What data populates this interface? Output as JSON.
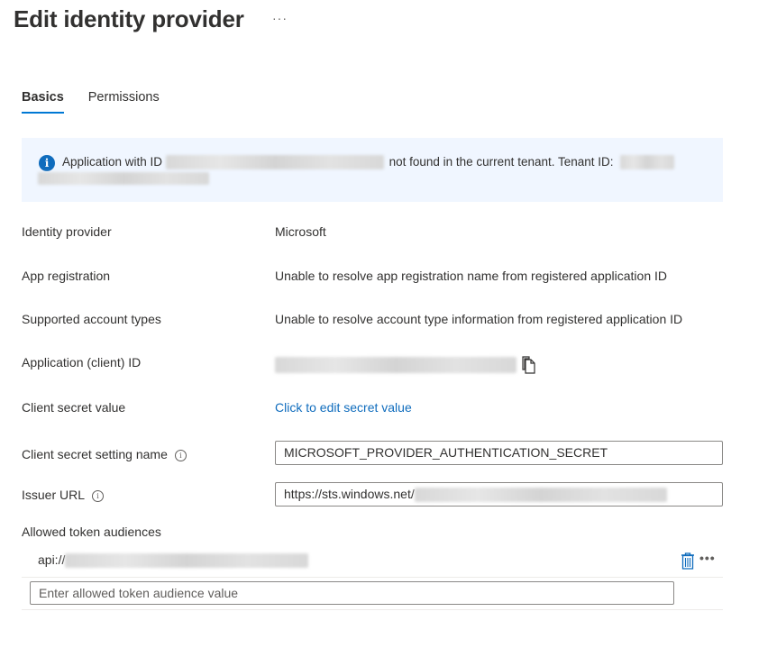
{
  "header": {
    "title": "Edit identity provider",
    "more_label": "···"
  },
  "tabs": [
    {
      "label": "Basics",
      "active": true
    },
    {
      "label": "Permissions",
      "active": false
    }
  ],
  "info_banner": {
    "icon": "info-icon",
    "text_before": "Application with ID",
    "text_middle": "not found in the current tenant. Tenant ID:",
    "redacted": true,
    "accent_color": "#0f6cbd",
    "background_color": "#f0f6ff"
  },
  "fields": {
    "identity_provider": {
      "label": "Identity provider",
      "value": "Microsoft"
    },
    "app_registration": {
      "label": "App registration",
      "value": "Unable to resolve app registration name from registered application ID"
    },
    "supported_account_types": {
      "label": "Supported account types",
      "value": "Unable to resolve account type information from registered application ID"
    },
    "application_client_id": {
      "label": "Application (client) ID",
      "value_redacted": true,
      "copy_icon": "copy-icon"
    },
    "client_secret_value": {
      "label": "Client secret value",
      "link": "Click to edit secret value"
    },
    "client_secret_setting_name": {
      "label": "Client secret setting name",
      "value": "MICROSOFT_PROVIDER_AUTHENTICATION_SECRET",
      "info_icon": "info-icon"
    },
    "issuer_url": {
      "label": "Issuer URL",
      "value_prefix": "https://sts.windows.net/",
      "info_icon": "info-icon"
    }
  },
  "allowed_token_audiences": {
    "label": "Allowed token audiences",
    "items": [
      {
        "prefix": "api://",
        "redacted": true
      }
    ],
    "input_placeholder": "Enter allowed token audience value",
    "more_label": "•••"
  },
  "colors": {
    "accent": "#0078d4",
    "link": "#0f6cbd",
    "text": "#323130"
  }
}
